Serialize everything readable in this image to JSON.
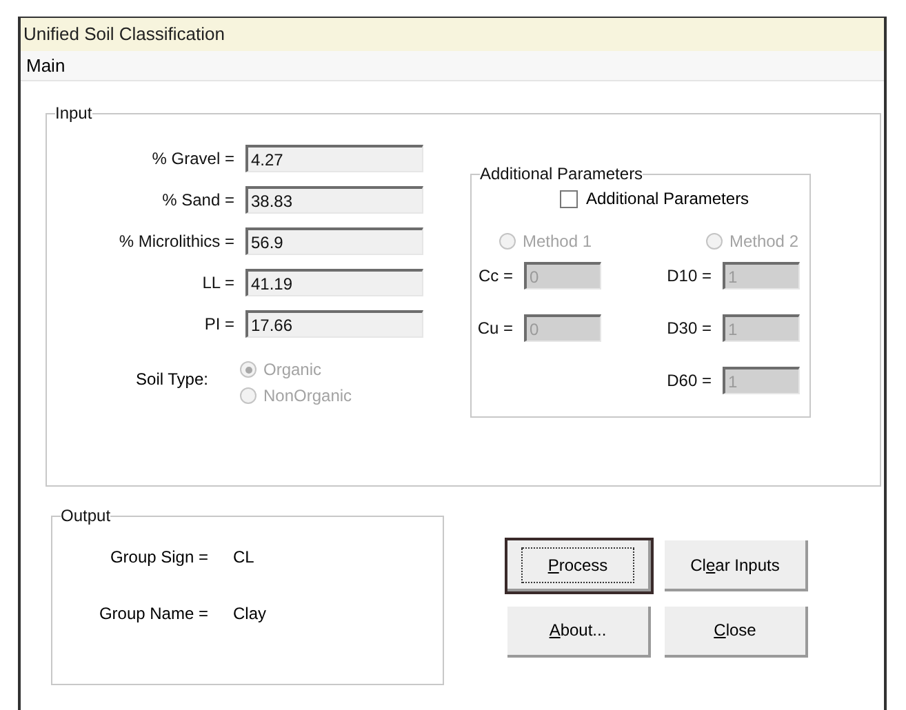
{
  "window": {
    "title": "Unified Soil Classification"
  },
  "menu": [
    {
      "label": "Main"
    }
  ],
  "input": {
    "title": "Input",
    "fields": [
      {
        "label": "% Gravel =",
        "value": "4.27"
      },
      {
        "label": "% Sand =",
        "value": "38.83"
      },
      {
        "label": "% Microlithics =",
        "value": "56.9"
      },
      {
        "label": "LL =",
        "value": "41.19"
      },
      {
        "label": "PI =",
        "value": "17.66"
      }
    ],
    "soil_type": {
      "label": "Soil Type:",
      "options": [
        {
          "label": "Organic",
          "selected": true,
          "disabled": true
        },
        {
          "label": "NonOrganic",
          "selected": false,
          "disabled": true
        }
      ]
    }
  },
  "additional": {
    "title": "Additional Parameters",
    "checkbox": {
      "label": "Additional Parameters",
      "checked": false
    },
    "methods": [
      {
        "label": "Method 1",
        "selected": false,
        "disabled": true
      },
      {
        "label": "Method 2",
        "selected": false,
        "disabled": true
      }
    ],
    "left_fields": [
      {
        "label": "Cc =",
        "value": "0",
        "disabled": true
      },
      {
        "label": "Cu =",
        "value": "0",
        "disabled": true
      }
    ],
    "right_fields": [
      {
        "label": "D10 =",
        "value": "1",
        "disabled": true
      },
      {
        "label": "D30 =",
        "value": "1",
        "disabled": true
      },
      {
        "label": "D60 =",
        "value": "1",
        "disabled": true
      }
    ]
  },
  "output": {
    "title": "Output",
    "rows": [
      {
        "label": "Group Sign =",
        "value": "CL"
      },
      {
        "label": "Group Name =",
        "value": "Clay"
      }
    ]
  },
  "buttons": [
    {
      "key": "P",
      "post": "rocess",
      "default": true
    },
    {
      "pre": "Cl",
      "key": "e",
      "post": "ar Inputs",
      "default": false
    },
    {
      "key": "A",
      "post": "bout...",
      "default": false
    },
    {
      "key": "C",
      "post": "lose",
      "default": false
    }
  ]
}
